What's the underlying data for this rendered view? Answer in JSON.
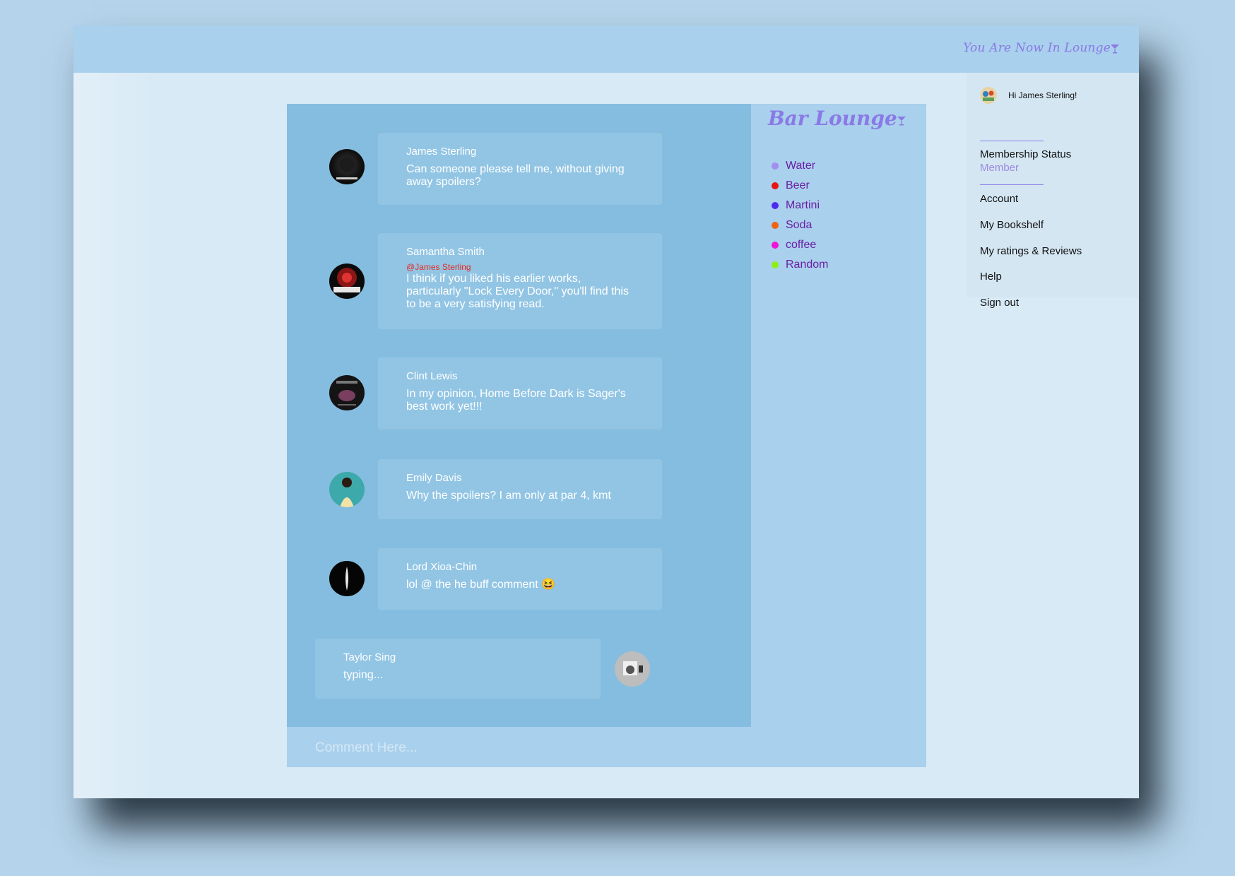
{
  "header": {
    "lounge_status": "You Are Now In Lounge"
  },
  "chat": {
    "messages": [
      {
        "name": "James Sterling",
        "mention": "",
        "text": "Can someone please tell me, without giving away spoilers?"
      },
      {
        "name": "Samantha Smith",
        "mention": "@James Sterling",
        "text": "I think if you liked his earlier works, particularly \"Lock Every Door,\" you'll find this to be a very satisfying read."
      },
      {
        "name": "Clint Lewis",
        "mention": "",
        "text": "In my opinion, Home Before Dark is Sager's best work yet!!!"
      },
      {
        "name": "Emily Davis",
        "mention": "",
        "text": "Why the spoilers? I am only at par 4, kmt"
      },
      {
        "name": "Lord Xioa-Chin",
        "mention": "",
        "text": "lol @ the he buff comment 😆"
      }
    ],
    "typing": {
      "name": "Taylor Sing",
      "status": "typing..."
    }
  },
  "lounge": {
    "title": "Bar Lounge",
    "drinks": [
      {
        "label": "Water",
        "color": "#a48cf0"
      },
      {
        "label": "Beer",
        "color": "#e81414"
      },
      {
        "label": "Martini",
        "color": "#4c2cf0"
      },
      {
        "label": "Soda",
        "color": "#f06214"
      },
      {
        "label": "coffee",
        "color": "#f014d8"
      },
      {
        "label": "Random",
        "color": "#8cf014"
      }
    ]
  },
  "comment": {
    "placeholder": "Comment Here..."
  },
  "user_menu": {
    "greeting": "Hi James Sterling!",
    "membership_label": "Membership Status",
    "membership_value": "Member",
    "items": [
      "Account",
      "My Bookshelf",
      "My ratings & Reviews",
      "Help",
      "Sign out"
    ]
  },
  "colors": {
    "accent": "#8a79e6",
    "chat_bg": "#85bde0",
    "bubble_bg": "#92c5e4",
    "mention": "#e8261e"
  }
}
